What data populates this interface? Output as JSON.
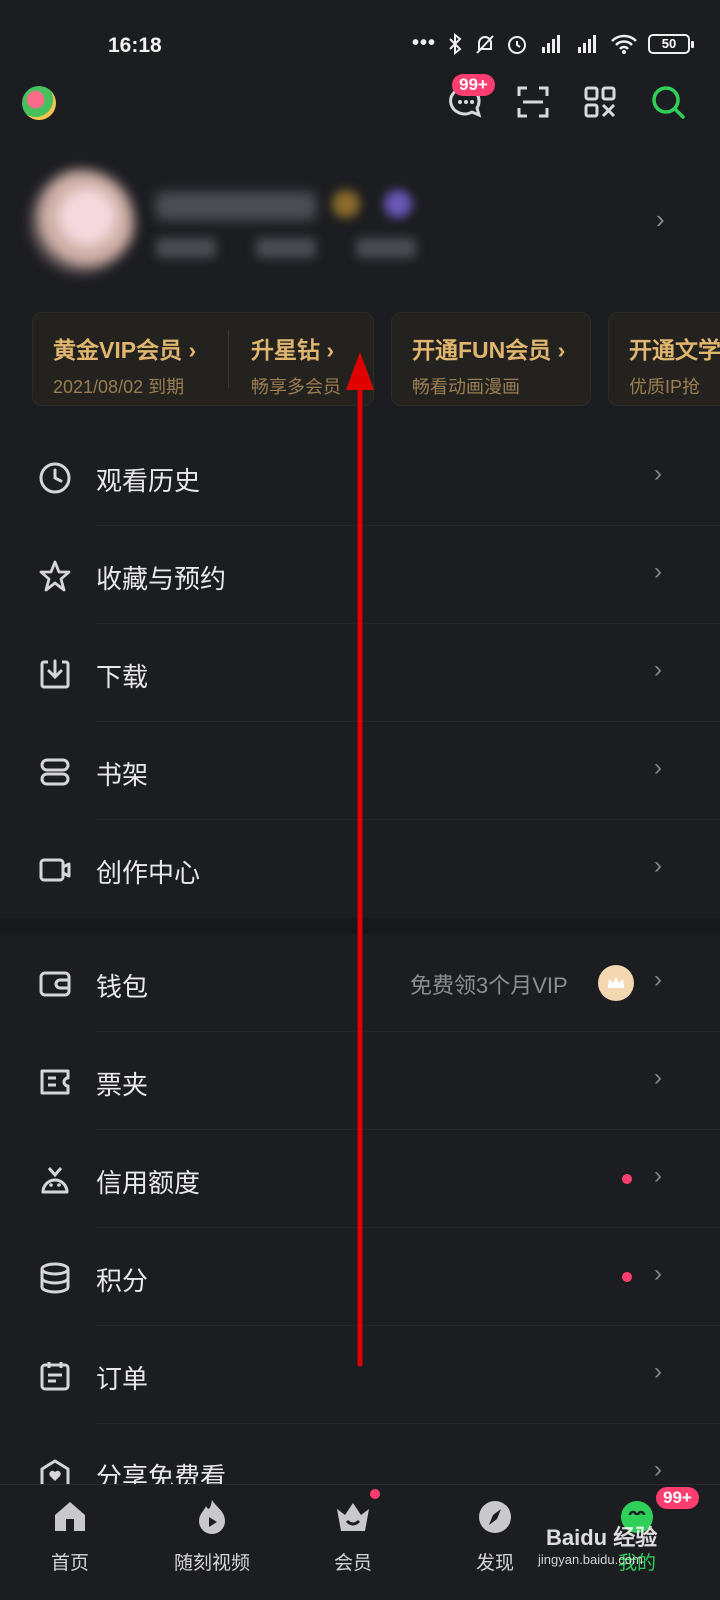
{
  "status": {
    "time": "16:18",
    "battery": "50"
  },
  "top": {
    "message_badge": "99+"
  },
  "vip_cards": [
    {
      "title": "黄金VIP会员",
      "sub": "2021/08/02 到期"
    },
    {
      "title": "升星钻",
      "sub": "畅享多会员"
    },
    {
      "title": "开通FUN会员",
      "sub": "畅看动画漫画"
    },
    {
      "title": "开通文学",
      "sub": "优质IP抢"
    }
  ],
  "menu": {
    "history": "观看历史",
    "favorites": "收藏与预约",
    "download": "下载",
    "bookshelf": "书架",
    "creator": "创作中心",
    "wallet": "钱包",
    "wallet_promo": "免费领3个月VIP",
    "tickets": "票夹",
    "credit": "信用额度",
    "points": "积分",
    "orders": "订单",
    "share": "分享免费看"
  },
  "nav": {
    "home": "首页",
    "shorts": "随刻视频",
    "vip": "会员",
    "discover": "发现",
    "mine": "我的",
    "mine_badge": "99+"
  },
  "watermark": {
    "brand": "Baidu 经验",
    "url": "jingyan.baidu.com"
  },
  "colors": {
    "accent_green": "#2fd05a",
    "gold": "#e0b56e",
    "badge_red": "#ff3d6e",
    "annotation_red": "#e00000"
  }
}
